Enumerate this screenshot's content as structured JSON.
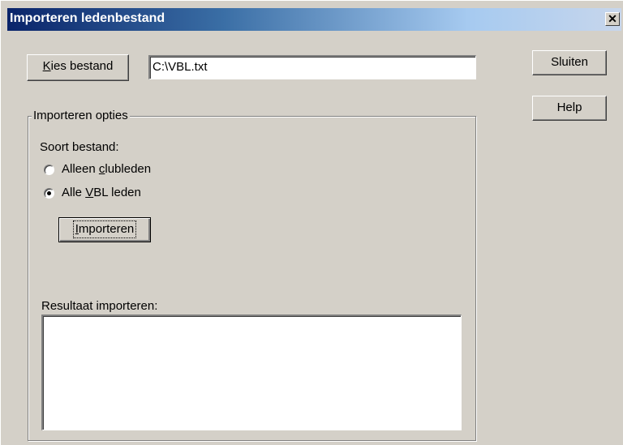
{
  "window": {
    "title": "Importeren ledenbestand",
    "close_glyph": "✕"
  },
  "file": {
    "choose_label_mnemonic": "K",
    "choose_label_rest": "ies bestand",
    "path_value": "C:\\VBL.txt"
  },
  "side_buttons": {
    "close_label": "Sluiten",
    "help_label": "Help"
  },
  "options": {
    "group_title": "Importeren opties",
    "file_type_label": "Soort bestand:",
    "radios": [
      {
        "pre": "Alleen ",
        "mnemonic": "c",
        "post": "lubleden",
        "checked": false
      },
      {
        "pre": "Alle ",
        "mnemonic": "V",
        "post": "BL leden",
        "checked": true
      }
    ],
    "import_mnemonic": "I",
    "import_rest": "mporteren",
    "result_label": "Resultaat importeren:",
    "result_value": ""
  },
  "colors": {
    "face": "#d4d0c8",
    "title_active": "#0a246a",
    "title_gradient_end": "#a6caf0"
  }
}
